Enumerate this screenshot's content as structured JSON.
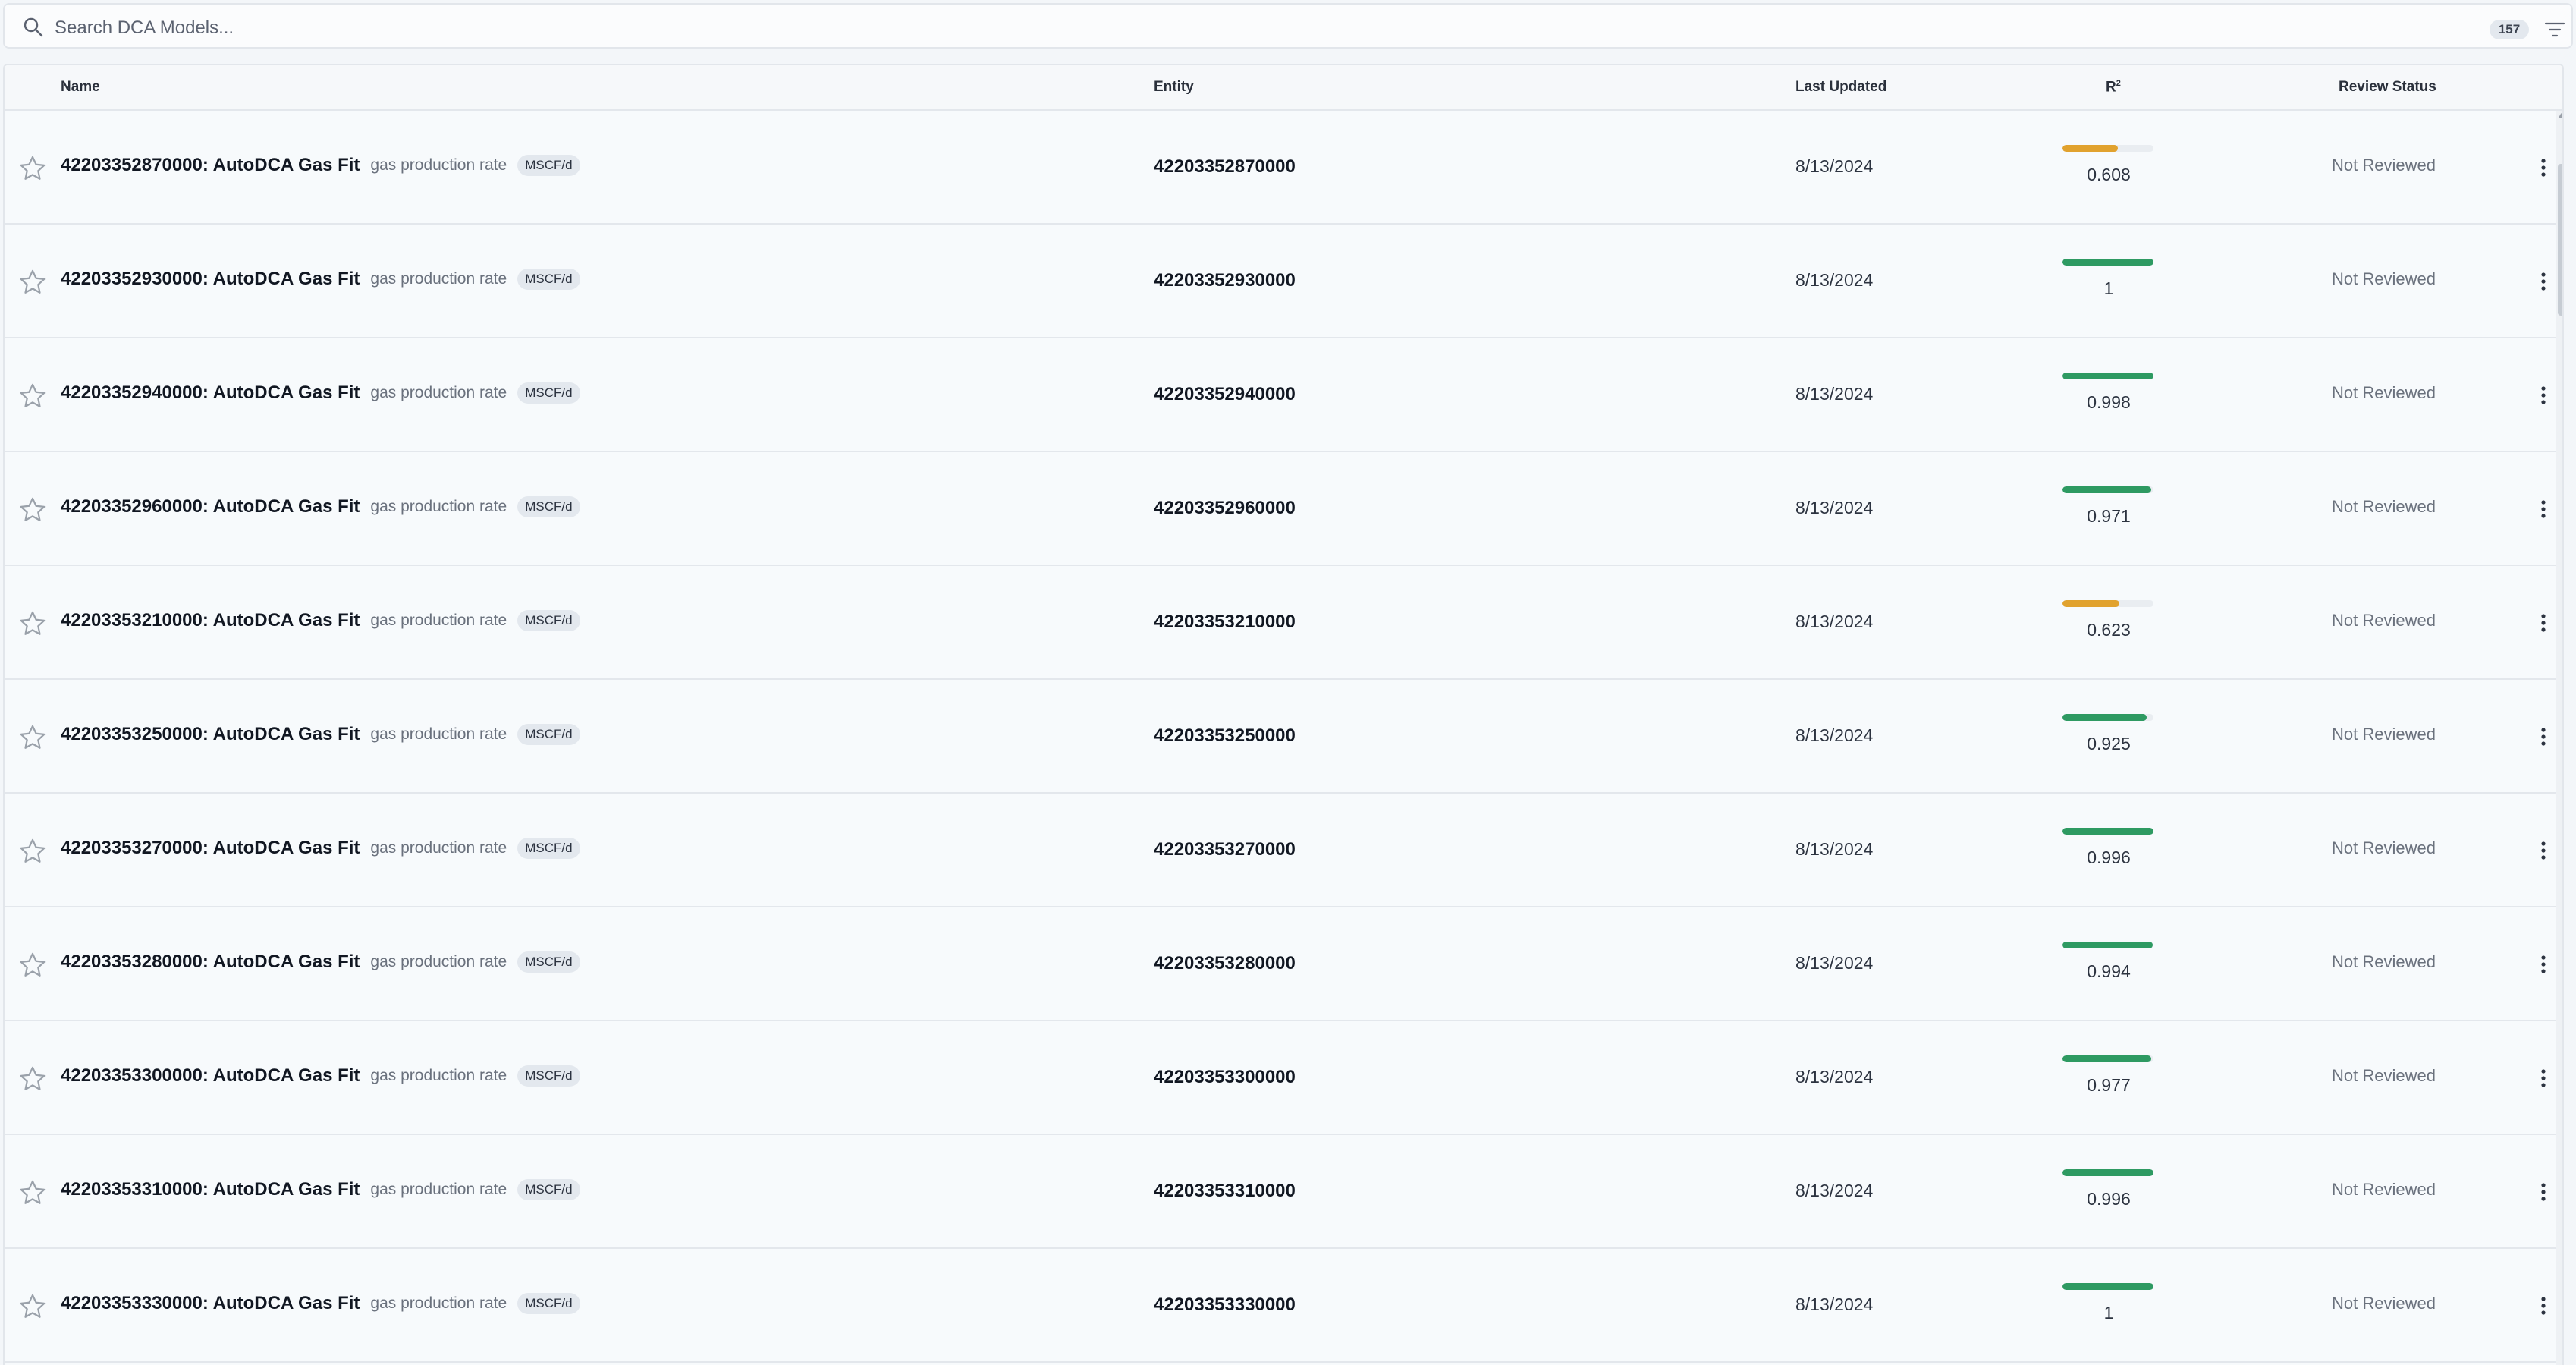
{
  "search": {
    "placeholder": "Search DCA Models...",
    "count": "157"
  },
  "columns": {
    "name": "Name",
    "entity": "Entity",
    "last_updated": "Last Updated",
    "r2": "R",
    "r2_sup": "2",
    "review_status": "Review Status"
  },
  "colors": {
    "good": "#2e9a62",
    "warn": "#e1a22e"
  },
  "rows": [
    {
      "name": "42203352870000: AutoDCA Gas Fit",
      "desc": "gas production rate",
      "unit": "MSCF/d",
      "entity": "42203352870000",
      "updated": "8/13/2024",
      "r2": "0.608",
      "r2_level": 0.608,
      "status": "Not Reviewed"
    },
    {
      "name": "42203352930000: AutoDCA Gas Fit",
      "desc": "gas production rate",
      "unit": "MSCF/d",
      "entity": "42203352930000",
      "updated": "8/13/2024",
      "r2": "1",
      "r2_level": 1,
      "status": "Not Reviewed"
    },
    {
      "name": "42203352940000: AutoDCA Gas Fit",
      "desc": "gas production rate",
      "unit": "MSCF/d",
      "entity": "42203352940000",
      "updated": "8/13/2024",
      "r2": "0.998",
      "r2_level": 0.998,
      "status": "Not Reviewed"
    },
    {
      "name": "42203352960000: AutoDCA Gas Fit",
      "desc": "gas production rate",
      "unit": "MSCF/d",
      "entity": "42203352960000",
      "updated": "8/13/2024",
      "r2": "0.971",
      "r2_level": 0.971,
      "status": "Not Reviewed"
    },
    {
      "name": "42203353210000: AutoDCA Gas Fit",
      "desc": "gas production rate",
      "unit": "MSCF/d",
      "entity": "42203353210000",
      "updated": "8/13/2024",
      "r2": "0.623",
      "r2_level": 0.623,
      "status": "Not Reviewed"
    },
    {
      "name": "42203353250000: AutoDCA Gas Fit",
      "desc": "gas production rate",
      "unit": "MSCF/d",
      "entity": "42203353250000",
      "updated": "8/13/2024",
      "r2": "0.925",
      "r2_level": 0.925,
      "status": "Not Reviewed"
    },
    {
      "name": "42203353270000: AutoDCA Gas Fit",
      "desc": "gas production rate",
      "unit": "MSCF/d",
      "entity": "42203353270000",
      "updated": "8/13/2024",
      "r2": "0.996",
      "r2_level": 0.996,
      "status": "Not Reviewed"
    },
    {
      "name": "42203353280000: AutoDCA Gas Fit",
      "desc": "gas production rate",
      "unit": "MSCF/d",
      "entity": "42203353280000",
      "updated": "8/13/2024",
      "r2": "0.994",
      "r2_level": 0.994,
      "status": "Not Reviewed"
    },
    {
      "name": "42203353300000: AutoDCA Gas Fit",
      "desc": "gas production rate",
      "unit": "MSCF/d",
      "entity": "42203353300000",
      "updated": "8/13/2024",
      "r2": "0.977",
      "r2_level": 0.977,
      "status": "Not Reviewed"
    },
    {
      "name": "42203353310000: AutoDCA Gas Fit",
      "desc": "gas production rate",
      "unit": "MSCF/d",
      "entity": "42203353310000",
      "updated": "8/13/2024",
      "r2": "0.996",
      "r2_level": 0.996,
      "status": "Not Reviewed"
    },
    {
      "name": "42203353330000: AutoDCA Gas Fit",
      "desc": "gas production rate",
      "unit": "MSCF/d",
      "entity": "42203353330000",
      "updated": "8/13/2024",
      "r2": "1",
      "r2_level": 1,
      "status": "Not Reviewed"
    }
  ]
}
